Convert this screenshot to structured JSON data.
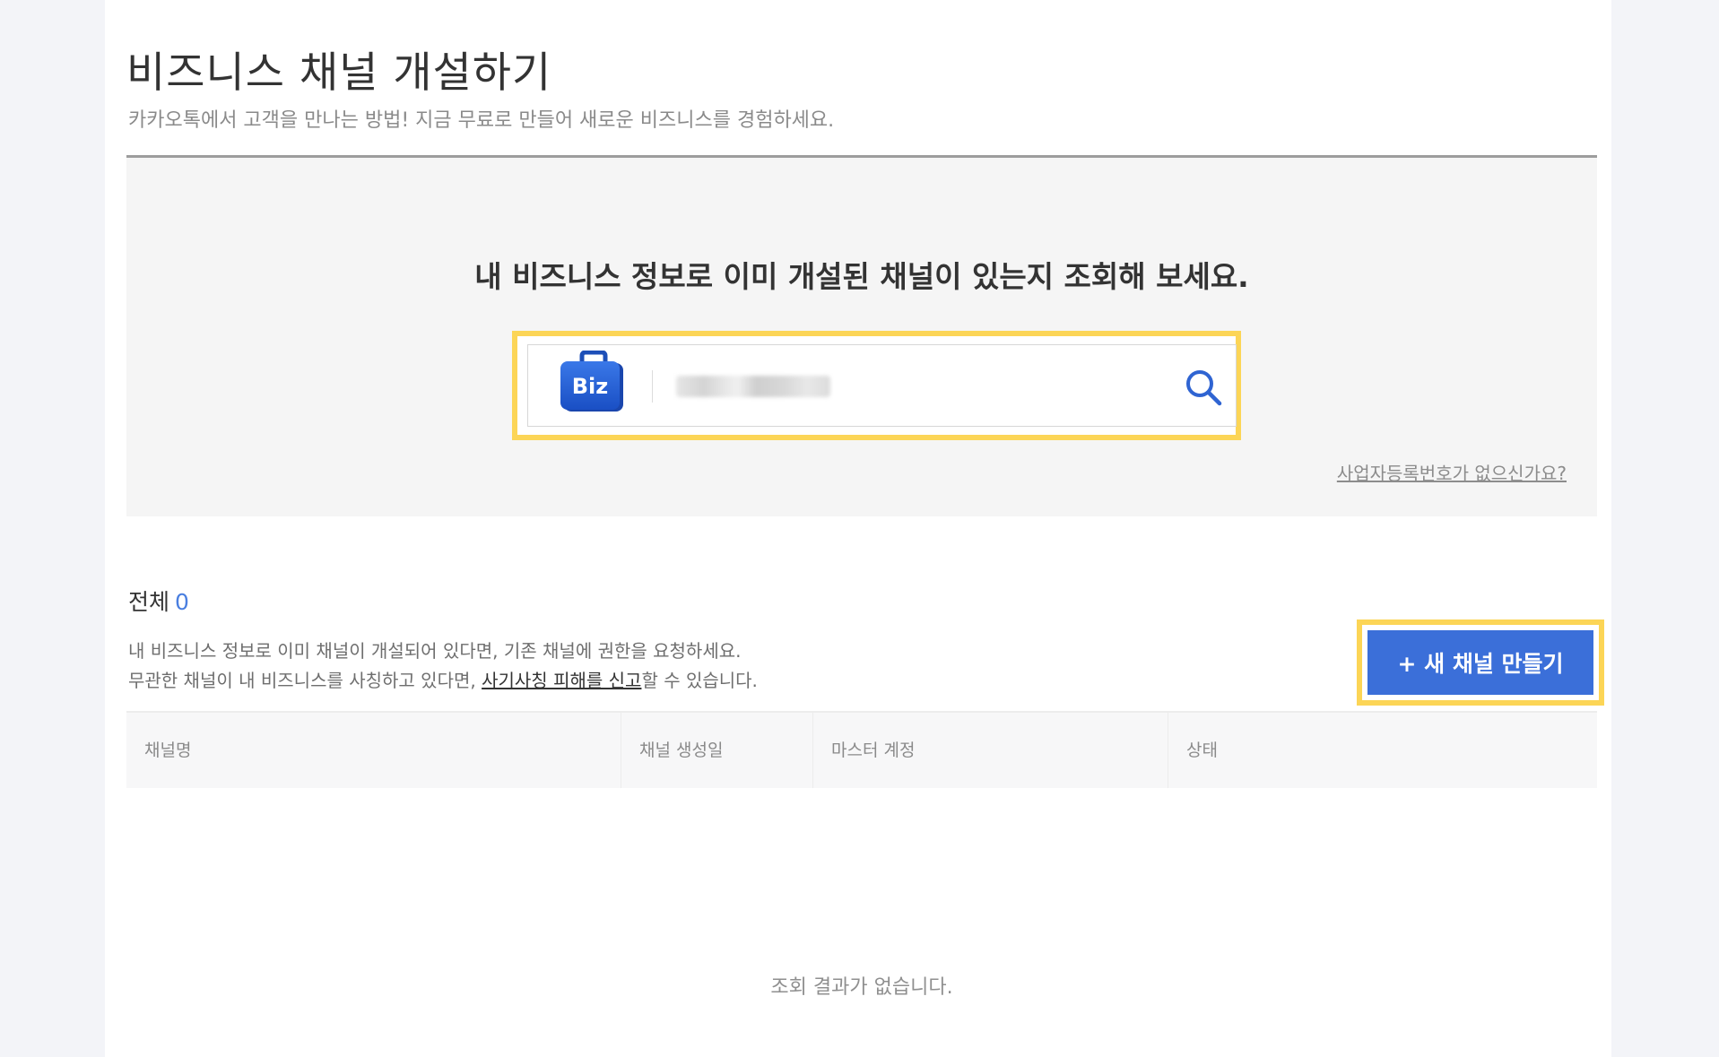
{
  "header": {
    "title": "비즈니스 채널 개설하기",
    "subtitle": "카카오톡에서 고객을 만나는 방법! 지금 무료로 만들어 새로운 비즈니스를 경험하세요."
  },
  "search": {
    "heading": "내 비즈니스 정보로 이미 개설된 채널이 있는지 조회해 보세요.",
    "badge_text": "Biz",
    "value": "",
    "no_brn_link": "사업자등록번호가 없으신가요?"
  },
  "results": {
    "total_label": "전체",
    "total_count": "0",
    "desc_line1": "내 비즈니스 정보로 이미 채널이 개설되어 있다면, 기존 채널에 권한을 요청하세요.",
    "desc_line2_pre": "무관한 채널이 내 비즈니스를 사칭하고 있다면, ",
    "desc_line2_link": "사기사칭 피해를 신고",
    "desc_line2_post": "할 수 있습니다.",
    "new_channel_button": "+ 새 채널 만들기",
    "columns": [
      "채널명",
      "채널 생성일",
      "마스터 계정",
      "상태"
    ],
    "empty_message": "조회 결과가 없습니다."
  },
  "colors": {
    "accent": "#3b6fd9",
    "highlight": "#fcd556",
    "count": "#4a7fe0"
  }
}
